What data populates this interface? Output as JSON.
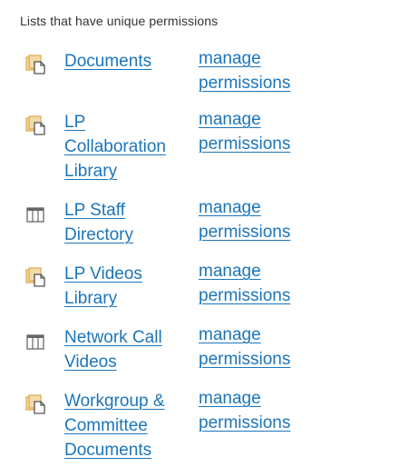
{
  "heading": "Lists that have unique permissions",
  "items": [
    {
      "name": "Documents",
      "icon": "document-library-icon",
      "action": "manage permissions"
    },
    {
      "name": "LP Collaboration Library",
      "icon": "document-library-icon",
      "action": "manage permissions"
    },
    {
      "name": "LP Staff Directory",
      "icon": "list-icon",
      "action": "manage permissions"
    },
    {
      "name": "LP Videos Library",
      "icon": "document-library-icon",
      "action": "manage permissions"
    },
    {
      "name": "Network Call Videos",
      "icon": "list-icon",
      "action": "manage permissions"
    },
    {
      "name": "Workgroup & Committee Documents",
      "icon": "document-library-icon",
      "action": "manage permissions"
    }
  ],
  "colors": {
    "link": "#1b75bb",
    "text": "#333333",
    "library_icon": "#e8c47a",
    "list_icon": "#666666"
  }
}
